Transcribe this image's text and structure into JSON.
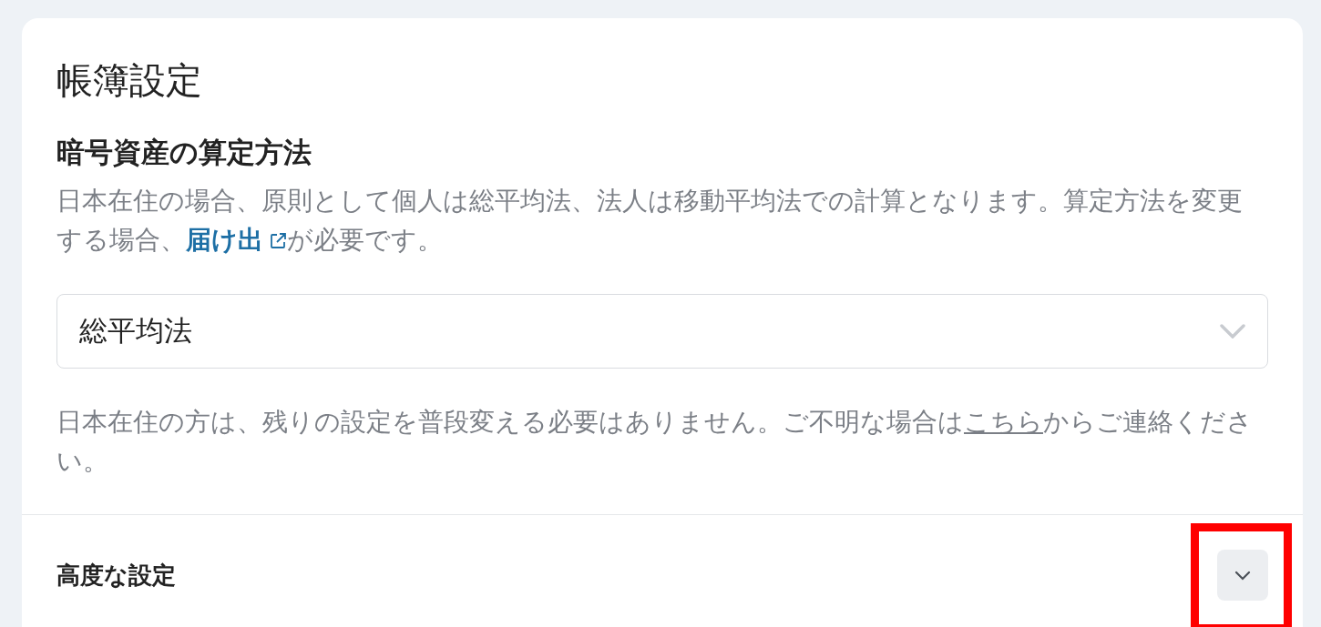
{
  "title": "帳簿設定",
  "method": {
    "heading": "暗号資産の算定方法",
    "description": {
      "before": "日本在住の場合、原則として個人は総平均法、法人は移動平均法での計算となります。算定方法を変更する場合、",
      "link": "届け出",
      "after": "が必要です。"
    },
    "select": {
      "value": "総平均法"
    },
    "note": {
      "before": "日本在住の方は、残りの設定を普段変える必要はありません。ご不明な場合は",
      "link": "こちら",
      "after": "からご連絡ください。"
    }
  },
  "advanced": {
    "label": "高度な設定",
    "expanded": false,
    "highlighted": true
  }
}
